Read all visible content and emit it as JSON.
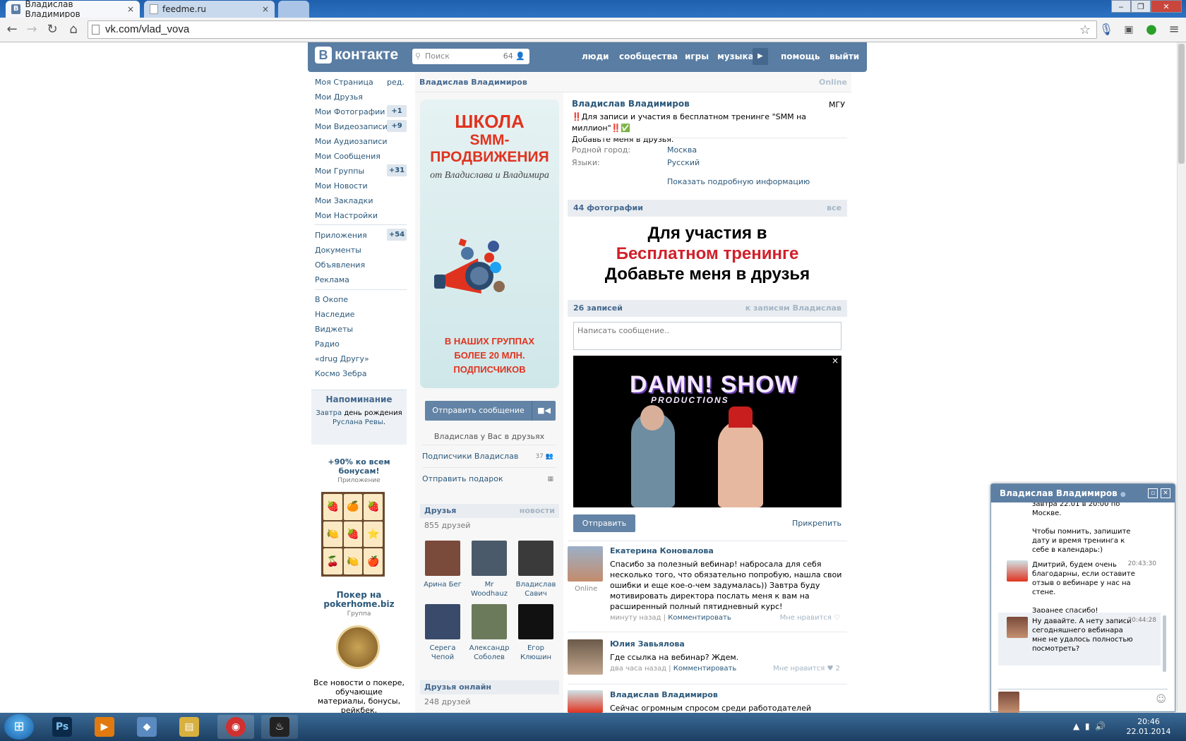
{
  "browser": {
    "tabs": [
      {
        "label": "Владислав Владимиров",
        "close": "×"
      },
      {
        "label": "feedme.ru",
        "close": "×"
      }
    ],
    "url": "vk.com/vlad_vova",
    "window_controls": [
      "‒",
      "❐",
      "✕"
    ]
  },
  "vk": {
    "logo": "контакте",
    "logo_badge": "В",
    "search": {
      "placeholder": "Поиск",
      "count": "64"
    },
    "nav": [
      "люди",
      "сообщества",
      "игры",
      "музыка",
      "помощь",
      "выйти"
    ]
  },
  "menu": {
    "items": [
      {
        "label": "Моя Страница",
        "extra": "ред."
      },
      {
        "label": "Мои Друзья"
      },
      {
        "label": "Мои Фотографии",
        "count": "+1"
      },
      {
        "label": "Мои Видеозаписи",
        "count": "+9"
      },
      {
        "label": "Мои Аудиозаписи"
      },
      {
        "label": "Мои Сообщения"
      },
      {
        "label": "Мои Группы",
        "count": "+31"
      },
      {
        "label": "Мои Новости"
      },
      {
        "label": "Мои Закладки"
      },
      {
        "label": "Мои Настройки"
      }
    ],
    "items2": [
      {
        "label": "Приложения",
        "count": "+54"
      },
      {
        "label": "Документы"
      },
      {
        "label": "Объявления"
      },
      {
        "label": "Реклама"
      }
    ],
    "items3": [
      "В Окопе",
      "Наследие",
      "Виджеты",
      "Радио",
      "«drug Другу»",
      "Космо Зебра"
    ]
  },
  "reminder": {
    "title": "Напоминание",
    "pre": "Завтра",
    "mid": "день рождения",
    "person": "Руслана Ревы",
    "end": "."
  },
  "ads": {
    "ad1": {
      "title": "+90% ко всем бонусам!",
      "sub": "Приложение"
    },
    "ad2": {
      "title": "Покер на pokerhome.biz",
      "sub": "Группа",
      "text": "Все новости о покере, обучающие материалы, бонусы, рейкбек,"
    }
  },
  "profile": {
    "header_name": "Владислав Владимиров",
    "online": "Online",
    "name": "Владислав Владимиров",
    "univ": "МГУ",
    "status_line1": "‼️Для записи и участия в бесплатном тренинге \"SMM на миллион\"‼️✅",
    "status_line2": "Добавьте меня в друзья.",
    "fields": [
      {
        "label": "Родной город:",
        "value": "Москва"
      },
      {
        "label": "Языки:",
        "value": "Русский"
      }
    ],
    "more_info": "Показать подробную информацию"
  },
  "banner": {
    "line1": "ШКОЛА",
    "line2": "SMM-ПРОДВИЖЕНИЯ",
    "line3": "от Владислава и Владимира",
    "line4": "В НАШИХ ГРУППАХ",
    "line5": "БОЛЕЕ 20 МЛН. ПОДПИСЧИКОВ"
  },
  "actions": {
    "send_message": "Отправить сообщение",
    "video_icon": "■◀",
    "friends_note": "Владислав у Вас в друзьях",
    "subscribers": "Подписчики Владислав",
    "subscribers_count": "37",
    "gift": "Отправить подарок"
  },
  "friends": {
    "title": "Друзья",
    "news": "новости",
    "count": "855 друзей",
    "list": [
      {
        "name": "Арина Бег",
        "color": "#7a4a3a"
      },
      {
        "name": "Mr Woodhauz",
        "color": "#4a5a6a"
      },
      {
        "name": "Владислав Савич",
        "color": "#3a3a3a"
      },
      {
        "name": "Серега Чепой",
        "color": "#3a4a6a"
      },
      {
        "name": "Александр Соболев",
        "color": "#6a7a5a"
      },
      {
        "name": "Егор Клюшин",
        "color": "#111111"
      }
    ],
    "online_title": "Друзья онлайн",
    "online_count": "248 друзей"
  },
  "photos": {
    "title": "44 фотографии",
    "all": "все",
    "text1": "Для участия в",
    "text2": "Бесплатном тренинге",
    "text3": "Добавьте меня в друзья"
  },
  "wall": {
    "title": "26 записей",
    "to_posts": "к записям Владислав",
    "input_placeholder": "Написать сообщение..",
    "video_title": "DAMN! SHOW",
    "video_sub": "PRODUCTIONS",
    "close": "×",
    "send": "Отправить",
    "attach": "Прикрепить",
    "posts": [
      {
        "author": "Екатерина Коновалова",
        "online": "Online",
        "text": "Спасибо за полезный вебинар! набросала для себя несколько того, что обязательно попробую, нашла свои ошибки и еще кое-о-чем задумалась)) Завтра буду мотивировать директора послать меня к вам на расширенный полный пятидневный курс!",
        "time": "минуту назад",
        "comment": "Комментировать",
        "like": "Мне нравится ♡"
      },
      {
        "author": "Юлия Завьялова",
        "text": "Где ссылка на вебинар? Ждем.",
        "time": "два часа назад",
        "comment": "Комментировать",
        "like": "Мне нравится ♥ 2"
      },
      {
        "author": "Владислав Владимиров",
        "text": "Сейчас огромным спросом среди работодателей пользуется"
      }
    ]
  },
  "chat": {
    "title": "Владислав Владимиров",
    "dot": "●",
    "messages": [
      {
        "text": "завтра 22.01 в 20:00 по Москве.\n\nЧтобы помнить, запишите дату и время тренинга к себе в календарь:)",
        "time": ""
      },
      {
        "text": "Дмитрий, будем очень благодарны, если оставите отзыв о вебинаре у нас на стене.\n\nЗаранее спасибо!",
        "time": "20:43:30"
      },
      {
        "text": "Ну давайте. А нету записи сегодняшнего вебинара мне не удалось полностью посмотреть?",
        "time": "20:44:28"
      }
    ]
  },
  "taskbar": {
    "apps": [
      {
        "icon": "Ps",
        "color": "#0b2a4a"
      },
      {
        "icon": "▶",
        "color": "#e07a10"
      },
      {
        "icon": "◆",
        "color": "#5a8ac0"
      },
      {
        "icon": "▤",
        "color": "#d8b040"
      },
      {
        "icon": "◉",
        "color": "#d03030"
      },
      {
        "icon": "♨",
        "color": "#222222"
      }
    ],
    "time": "20:46",
    "date": "22.01.2014"
  },
  "colors": {
    "vk_blue": "#597da3",
    "link": "#2b587a",
    "accent_red": "#e0331f"
  }
}
